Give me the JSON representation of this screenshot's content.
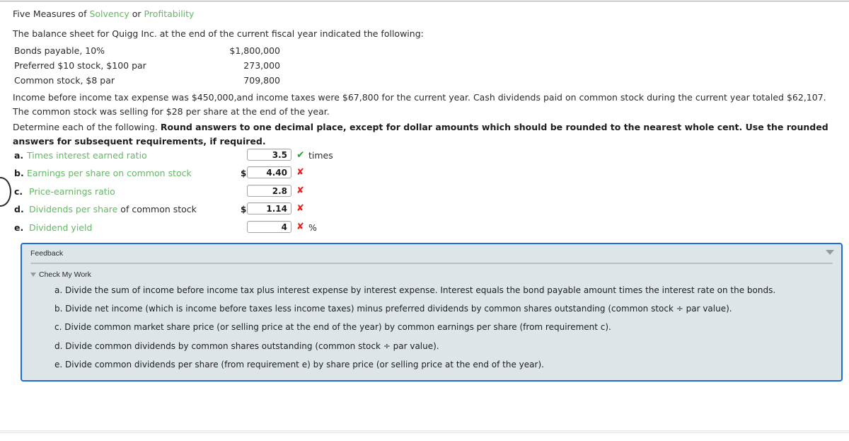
{
  "header": {
    "title_prefix": "Five Measures of ",
    "title_link_1": "Solvency",
    "title_mid": " or ",
    "title_link_2": "Profitability"
  },
  "intro": "The balance sheet for Quigg Inc. at the end of the current fiscal year indicated the following:",
  "balance_sheet": {
    "rows": [
      {
        "label": "Bonds payable, 10%",
        "amount": "$1,800,000"
      },
      {
        "label": "Preferred $10 stock, $100 par",
        "amount": "273,000"
      },
      {
        "label": "Common stock, $8 par",
        "amount": "709,800"
      }
    ]
  },
  "paragraphs": {
    "income": "Income before income tax expense was $450,000,and income taxes were $67,800 for the current year. Cash dividends paid on common stock during the current year totaled $62,107. The common stock was selling for $28 per share at the end of the year.",
    "determine_lead": "Determine each of the following. ",
    "determine_bold": "Round answers to one decimal place, except for dollar amounts which should be rounded to the nearest whole cent. Use the rounded answers for subsequent requirements, if required."
  },
  "answers": [
    {
      "letter": "a.",
      "label_green": "Times interest earned ratio",
      "label_dark": "",
      "prefix": "",
      "value": "3.5",
      "status": "correct",
      "status_glyph": "✔",
      "unit": "times"
    },
    {
      "letter": "b.",
      "label_green": "Earnings per share on common stock",
      "label_dark": "",
      "prefix": "$",
      "value": "4.40",
      "status": "incorrect",
      "status_glyph": "✘",
      "unit": ""
    },
    {
      "letter": "c.",
      "label_green": "Price-earnings ratio",
      "label_dark": "",
      "prefix": "",
      "value": "2.8",
      "status": "incorrect",
      "status_glyph": "✘",
      "unit": ""
    },
    {
      "letter": "d.",
      "label_green": "Dividends per share",
      "label_dark": " of common stock",
      "prefix": "$",
      "value": "1.14",
      "status": "incorrect",
      "status_glyph": "✘",
      "unit": ""
    },
    {
      "letter": "e.",
      "label_green": "Dividend yield",
      "label_dark": "",
      "prefix": "",
      "value": "4",
      "status": "incorrect",
      "status_glyph": "✘",
      "unit": "%"
    }
  ],
  "feedback": {
    "title": "Feedback",
    "check_my_work": "Check My Work",
    "items": [
      "a. Divide the sum of income before income tax plus interest expense by interest expense. Interest equals the bond payable amount times the interest rate on the bonds.",
      "b. Divide net income (which is income before taxes less income taxes) minus preferred dividends by common shares outstanding (common stock ÷ par value).",
      "c. Divide common market share price (or selling price at the end of the year) by common earnings per share (from requirement c).",
      "d. Divide common dividends by common shares outstanding (common stock ÷ par value).",
      "e. Divide common dividends per share (from requirement e) by share price (or selling price at the end of the year)."
    ]
  },
  "colors": {
    "link_green": "#63b863",
    "correct_green": "#23a838",
    "incorrect_red": "#f01c1c",
    "panel_border_blue": "#1a6fd4",
    "panel_bg": "#dde5e9"
  }
}
